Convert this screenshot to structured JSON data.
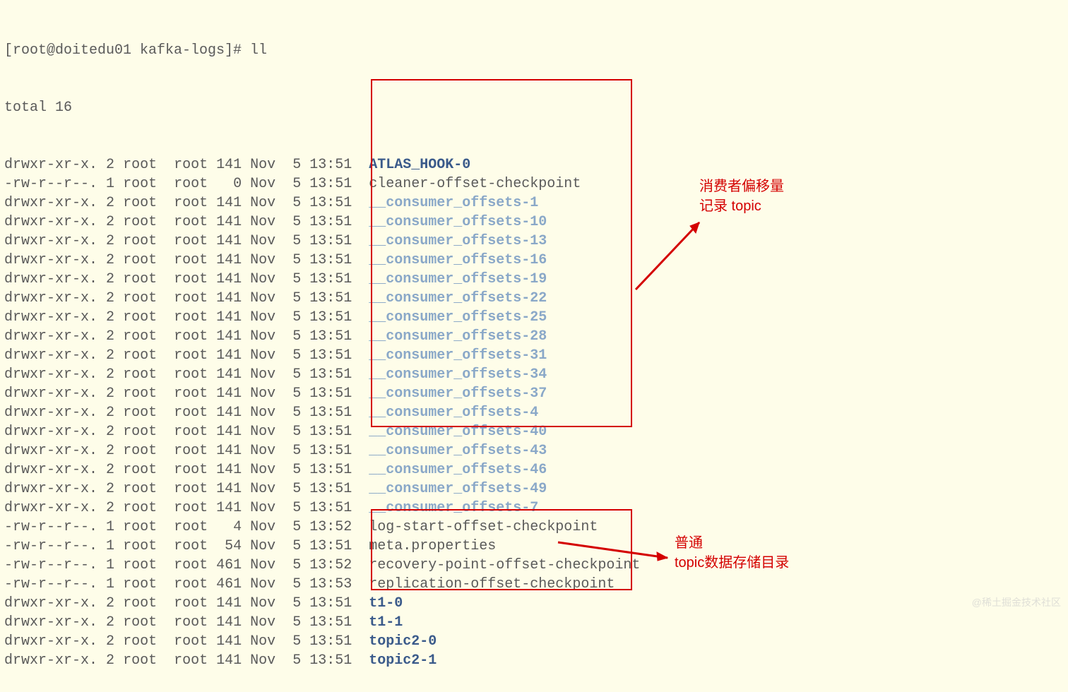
{
  "prompt": "[root@doitedu01 kafka-logs]# ll",
  "total": "total 16",
  "annotation1_line1": "消费者偏移量",
  "annotation1_line2": "记录 topic",
  "annotation2_line1": "普通",
  "annotation2_line2": "topic数据存储目录",
  "watermark": "@稀土掘金技术社区",
  "rows": [
    {
      "perm": "drwxr-xr-x.",
      "links": "2",
      "owner": "root",
      "group": "root",
      "size": "141",
      "month": "Nov",
      "day": "5",
      "time": "13:51",
      "name": "ATLAS_HOOK-0",
      "style": "dir"
    },
    {
      "perm": "-rw-r--r--.",
      "links": "1",
      "owner": "root",
      "group": "root",
      "size": "0",
      "month": "Nov",
      "day": "5",
      "time": "13:51",
      "name": "cleaner-offset-checkpoint",
      "style": "file"
    },
    {
      "perm": "drwxr-xr-x.",
      "links": "2",
      "owner": "root",
      "group": "root",
      "size": "141",
      "month": "Nov",
      "day": "5",
      "time": "13:51",
      "name": "__consumer_offsets-1",
      "style": "consumer"
    },
    {
      "perm": "drwxr-xr-x.",
      "links": "2",
      "owner": "root",
      "group": "root",
      "size": "141",
      "month": "Nov",
      "day": "5",
      "time": "13:51",
      "name": "__consumer_offsets-10",
      "style": "consumer"
    },
    {
      "perm": "drwxr-xr-x.",
      "links": "2",
      "owner": "root",
      "group": "root",
      "size": "141",
      "month": "Nov",
      "day": "5",
      "time": "13:51",
      "name": "__consumer_offsets-13",
      "style": "consumer"
    },
    {
      "perm": "drwxr-xr-x.",
      "links": "2",
      "owner": "root",
      "group": "root",
      "size": "141",
      "month": "Nov",
      "day": "5",
      "time": "13:51",
      "name": "__consumer_offsets-16",
      "style": "consumer"
    },
    {
      "perm": "drwxr-xr-x.",
      "links": "2",
      "owner": "root",
      "group": "root",
      "size": "141",
      "month": "Nov",
      "day": "5",
      "time": "13:51",
      "name": "__consumer_offsets-19",
      "style": "consumer"
    },
    {
      "perm": "drwxr-xr-x.",
      "links": "2",
      "owner": "root",
      "group": "root",
      "size": "141",
      "month": "Nov",
      "day": "5",
      "time": "13:51",
      "name": "__consumer_offsets-22",
      "style": "consumer"
    },
    {
      "perm": "drwxr-xr-x.",
      "links": "2",
      "owner": "root",
      "group": "root",
      "size": "141",
      "month": "Nov",
      "day": "5",
      "time": "13:51",
      "name": "__consumer_offsets-25",
      "style": "consumer"
    },
    {
      "perm": "drwxr-xr-x.",
      "links": "2",
      "owner": "root",
      "group": "root",
      "size": "141",
      "month": "Nov",
      "day": "5",
      "time": "13:51",
      "name": "__consumer_offsets-28",
      "style": "consumer"
    },
    {
      "perm": "drwxr-xr-x.",
      "links": "2",
      "owner": "root",
      "group": "root",
      "size": "141",
      "month": "Nov",
      "day": "5",
      "time": "13:51",
      "name": "__consumer_offsets-31",
      "style": "consumer"
    },
    {
      "perm": "drwxr-xr-x.",
      "links": "2",
      "owner": "root",
      "group": "root",
      "size": "141",
      "month": "Nov",
      "day": "5",
      "time": "13:51",
      "name": "__consumer_offsets-34",
      "style": "consumer"
    },
    {
      "perm": "drwxr-xr-x.",
      "links": "2",
      "owner": "root",
      "group": "root",
      "size": "141",
      "month": "Nov",
      "day": "5",
      "time": "13:51",
      "name": "__consumer_offsets-37",
      "style": "consumer"
    },
    {
      "perm": "drwxr-xr-x.",
      "links": "2",
      "owner": "root",
      "group": "root",
      "size": "141",
      "month": "Nov",
      "day": "5",
      "time": "13:51",
      "name": "__consumer_offsets-4",
      "style": "consumer"
    },
    {
      "perm": "drwxr-xr-x.",
      "links": "2",
      "owner": "root",
      "group": "root",
      "size": "141",
      "month": "Nov",
      "day": "5",
      "time": "13:51",
      "name": "__consumer_offsets-40",
      "style": "consumer"
    },
    {
      "perm": "drwxr-xr-x.",
      "links": "2",
      "owner": "root",
      "group": "root",
      "size": "141",
      "month": "Nov",
      "day": "5",
      "time": "13:51",
      "name": "__consumer_offsets-43",
      "style": "consumer"
    },
    {
      "perm": "drwxr-xr-x.",
      "links": "2",
      "owner": "root",
      "group": "root",
      "size": "141",
      "month": "Nov",
      "day": "5",
      "time": "13:51",
      "name": "__consumer_offsets-46",
      "style": "consumer"
    },
    {
      "perm": "drwxr-xr-x.",
      "links": "2",
      "owner": "root",
      "group": "root",
      "size": "141",
      "month": "Nov",
      "day": "5",
      "time": "13:51",
      "name": "__consumer_offsets-49",
      "style": "consumer"
    },
    {
      "perm": "drwxr-xr-x.",
      "links": "2",
      "owner": "root",
      "group": "root",
      "size": "141",
      "month": "Nov",
      "day": "5",
      "time": "13:51",
      "name": "__consumer_offsets-7",
      "style": "consumer"
    },
    {
      "perm": "-rw-r--r--.",
      "links": "1",
      "owner": "root",
      "group": "root",
      "size": "4",
      "month": "Nov",
      "day": "5",
      "time": "13:52",
      "name": "log-start-offset-checkpoint",
      "style": "file"
    },
    {
      "perm": "-rw-r--r--.",
      "links": "1",
      "owner": "root",
      "group": "root",
      "size": "54",
      "month": "Nov",
      "day": "5",
      "time": "13:51",
      "name": "meta.properties",
      "style": "file"
    },
    {
      "perm": "-rw-r--r--.",
      "links": "1",
      "owner": "root",
      "group": "root",
      "size": "461",
      "month": "Nov",
      "day": "5",
      "time": "13:52",
      "name": "recovery-point-offset-checkpoint",
      "style": "file"
    },
    {
      "perm": "-rw-r--r--.",
      "links": "1",
      "owner": "root",
      "group": "root",
      "size": "461",
      "month": "Nov",
      "day": "5",
      "time": "13:53",
      "name": "replication-offset-checkpoint",
      "style": "file"
    },
    {
      "perm": "drwxr-xr-x.",
      "links": "2",
      "owner": "root",
      "group": "root",
      "size": "141",
      "month": "Nov",
      "day": "5",
      "time": "13:51",
      "name": "t1-0",
      "style": "dir"
    },
    {
      "perm": "drwxr-xr-x.",
      "links": "2",
      "owner": "root",
      "group": "root",
      "size": "141",
      "month": "Nov",
      "day": "5",
      "time": "13:51",
      "name": "t1-1",
      "style": "dir"
    },
    {
      "perm": "drwxr-xr-x.",
      "links": "2",
      "owner": "root",
      "group": "root",
      "size": "141",
      "month": "Nov",
      "day": "5",
      "time": "13:51",
      "name": "topic2-0",
      "style": "dir"
    },
    {
      "perm": "drwxr-xr-x.",
      "links": "2",
      "owner": "root",
      "group": "root",
      "size": "141",
      "month": "Nov",
      "day": "5",
      "time": "13:51",
      "name": "topic2-1",
      "style": "dir"
    }
  ]
}
